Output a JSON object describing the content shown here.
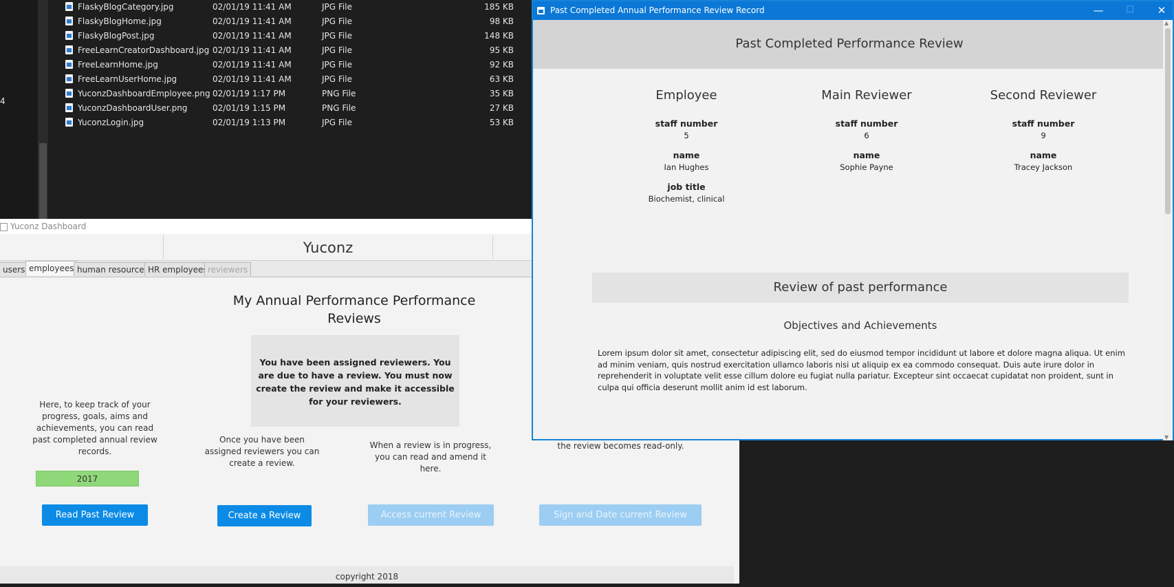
{
  "explorer": {
    "files": [
      {
        "name": "FlaskyBlogCategory.jpg",
        "date": "02/01/19 11:41 AM",
        "type": "JPG File",
        "size": "185 KB"
      },
      {
        "name": "FlaskyBlogHome.jpg",
        "date": "02/01/19 11:41 AM",
        "type": "JPG File",
        "size": "98 KB"
      },
      {
        "name": "FlaskyBlogPost.jpg",
        "date": "02/01/19 11:41 AM",
        "type": "JPG File",
        "size": "148 KB"
      },
      {
        "name": "FreeLearnCreatorDashboard.jpg",
        "date": "02/01/19 11:41 AM",
        "type": "JPG File",
        "size": "95 KB"
      },
      {
        "name": "FreeLearnHome.jpg",
        "date": "02/01/19 11:41 AM",
        "type": "JPG File",
        "size": "92 KB"
      },
      {
        "name": "FreeLearnUserHome.jpg",
        "date": "02/01/19 11:41 AM",
        "type": "JPG File",
        "size": "63 KB"
      },
      {
        "name": "YuconzDashboardEmployee.png",
        "date": "02/01/19 1:17 PM",
        "type": "PNG File",
        "size": "35 KB"
      },
      {
        "name": "YuconzDashboardUser.png",
        "date": "02/01/19 1:15 PM",
        "type": "PNG File",
        "size": "27 KB"
      },
      {
        "name": "YuconzLogin.jpg",
        "date": "02/01/19 1:13 PM",
        "type": "JPG File",
        "size": "53 KB"
      }
    ],
    "left_marker": "4"
  },
  "dashboard": {
    "window_title": "Yuconz Dashboard",
    "brand": "Yuconz",
    "tabs": [
      {
        "label": "users",
        "state": "normal"
      },
      {
        "label": "employees",
        "state": "active"
      },
      {
        "label": "human resources",
        "state": "normal"
      },
      {
        "label": "HR employees",
        "state": "normal"
      },
      {
        "label": "reviewers",
        "state": "disabled"
      }
    ],
    "heading": "My Annual Performance Performance Reviews",
    "notice": "You have been assigned reviewers. You are due to have a review. You must now create the review and make it accessible for your reviewers.",
    "desc_past": "Here, to keep track of your progress, goals, aims and achievements, you can read past completed annual review records.",
    "desc_create": "Once you have been assigned reviewers you can create a review.",
    "desc_access": "When a review is in progress, you can read and amend it here.",
    "desc_sign": "the review becomes read-only.",
    "year_selected": "2017",
    "buttons": {
      "read_past": "Read Past Review",
      "create": "Create a Review",
      "access": "Access current Review",
      "sign": "Sign and Date current Review"
    },
    "footer": "copyright 2018"
  },
  "popup": {
    "window_title": "Past Completed Annual Performance Review Record",
    "controls": {
      "minimize": "—",
      "maximize": "☐",
      "close": "✕"
    },
    "header": "Past Completed Performance Review",
    "employee": {
      "title": "Employee",
      "staff_label": "staff number",
      "staff": "5",
      "name_label": "name",
      "name": "Ian Hughes",
      "job_label": "job title",
      "job": "Biochemist, clinical"
    },
    "main_reviewer": {
      "title": "Main Reviewer",
      "staff_label": "staff number",
      "staff": "6",
      "name_label": "name",
      "name": "Sophie Payne"
    },
    "second_reviewer": {
      "title": "Second Reviewer",
      "staff_label": "staff number",
      "staff": "9",
      "name_label": "name",
      "name": "Tracey Jackson"
    },
    "review_section": "Review of past performance",
    "objectives_title": "Objectives and Achievements",
    "objectives_text": "Lorem ipsum dolor sit amet, consectetur adipiscing elit, sed do eiusmod tempor incididunt ut labore et dolore magna aliqua. Ut enim ad minim veniam, quis nostrud exercitation ullamco laboris nisi ut aliquip ex ea commodo consequat. Duis aute irure dolor in reprehenderit in voluptate velit esse cillum dolore eu fugiat nulla pariatur. Excepteur sint occaecat cupidatat non proident, sunt in culpa qui officia deserunt mollit anim id est laborum."
  },
  "colors": {
    "accent": "#0b8be6",
    "titlebar": "#0b78d7",
    "year_badge": "#8fd87a",
    "disabled_button": "#9ccdf2"
  }
}
